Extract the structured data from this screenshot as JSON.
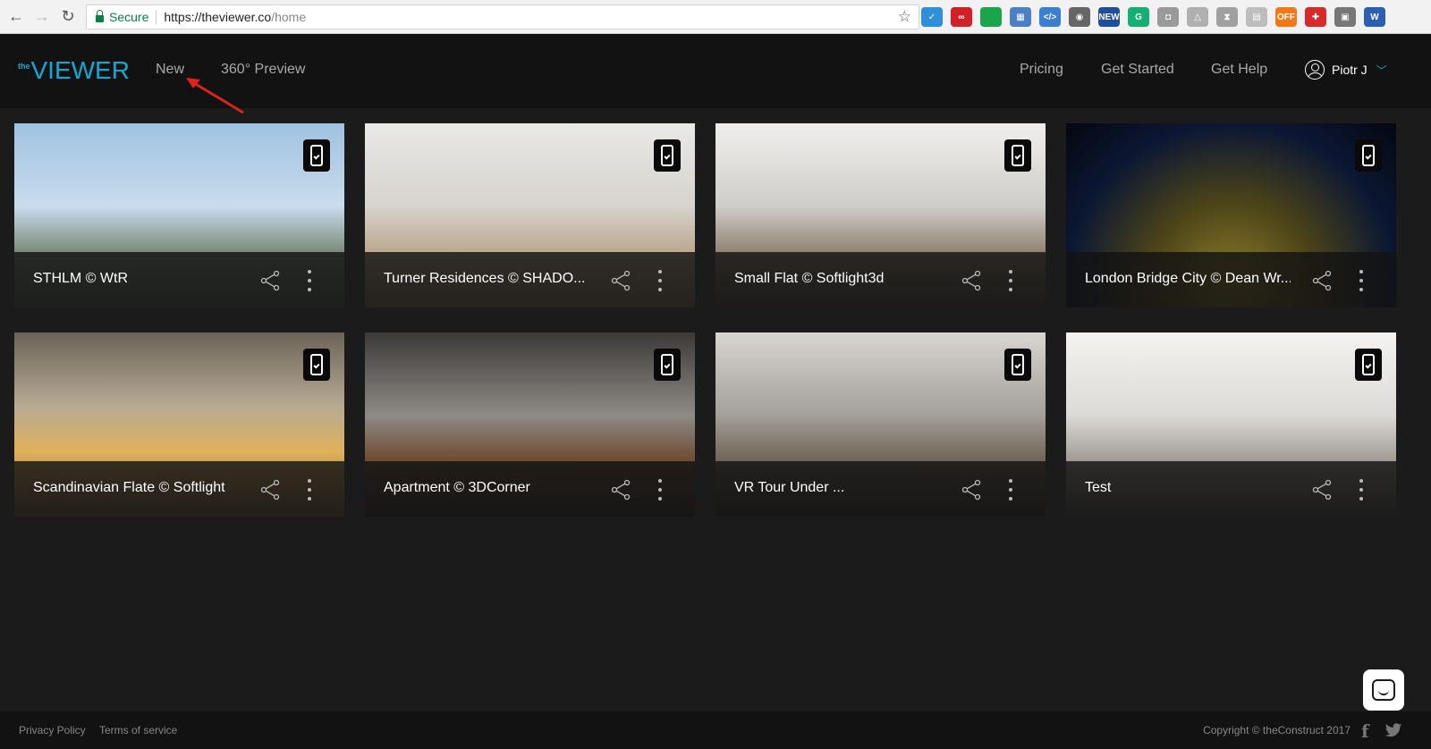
{
  "browser": {
    "secure_label": "Secure",
    "url_host": "https://theviewer.co",
    "url_path": "/home",
    "extensions": [
      {
        "name": "shield-ext-icon",
        "color": "#2f8fd8",
        "text": "✓"
      },
      {
        "name": "lastpass-ext-icon",
        "color": "#d32027",
        "text": "∞"
      },
      {
        "name": "green-dot-ext-icon",
        "color": "#1ba54b",
        "text": ""
      },
      {
        "name": "grid-ext-icon",
        "color": "#4b80c7",
        "text": "▦"
      },
      {
        "name": "dev-ext-icon",
        "color": "#3b7fcf",
        "text": "</>"
      },
      {
        "name": "bulb-ext-icon",
        "color": "#666666",
        "text": "◉"
      },
      {
        "name": "new-ext-icon",
        "color": "#1f4e9a",
        "text": "NEW"
      },
      {
        "name": "grammarly-ext-icon",
        "color": "#14b073",
        "text": "G"
      },
      {
        "name": "camera-ext-icon",
        "color": "#9a9a9a",
        "text": "◘"
      },
      {
        "name": "drive-ext-icon",
        "color": "#b0b0b0",
        "text": "△"
      },
      {
        "name": "hourglass-ext-icon",
        "color": "#a0a0a0",
        "text": "⧗"
      },
      {
        "name": "page-ext-icon",
        "color": "#bdbdbd",
        "text": "▤"
      },
      {
        "name": "off-ext-icon",
        "color": "#f07a1a",
        "text": "OFF"
      },
      {
        "name": "puzzle-ext-icon",
        "color": "#d82a2a",
        "text": "✚"
      },
      {
        "name": "window-ext-icon",
        "color": "#777777",
        "text": "▣"
      },
      {
        "name": "word-ext-icon",
        "color": "#2b5fb3",
        "text": "W"
      }
    ]
  },
  "header": {
    "logo_small": "the",
    "logo_main": "VIEWER",
    "nav": [
      "New",
      "360° Preview"
    ],
    "right_nav": [
      "Pricing",
      "Get Started",
      "Get Help"
    ],
    "user_name": "Piotr J"
  },
  "cards": [
    {
      "title": "STHLM © WtR"
    },
    {
      "title": "Turner Residences © SHADO..."
    },
    {
      "title": "Small Flat © Softlight3d"
    },
    {
      "title": "London Bridge City © Dean Wr..."
    },
    {
      "title": "Scandinavian Flate © Softlight"
    },
    {
      "title": "Apartment © 3DCorner"
    },
    {
      "title": "VR Tour Under ..."
    },
    {
      "title": "Test"
    }
  ],
  "footer": {
    "privacy": "Privacy Policy",
    "terms": "Terms of service",
    "copyright": "Copyright © theConstruct 2017"
  },
  "colors": {
    "accent": "#12a9d4",
    "header_bg": "#121212",
    "page_bg": "#1b1b1b",
    "annotation_arrow": "#d9231c"
  }
}
